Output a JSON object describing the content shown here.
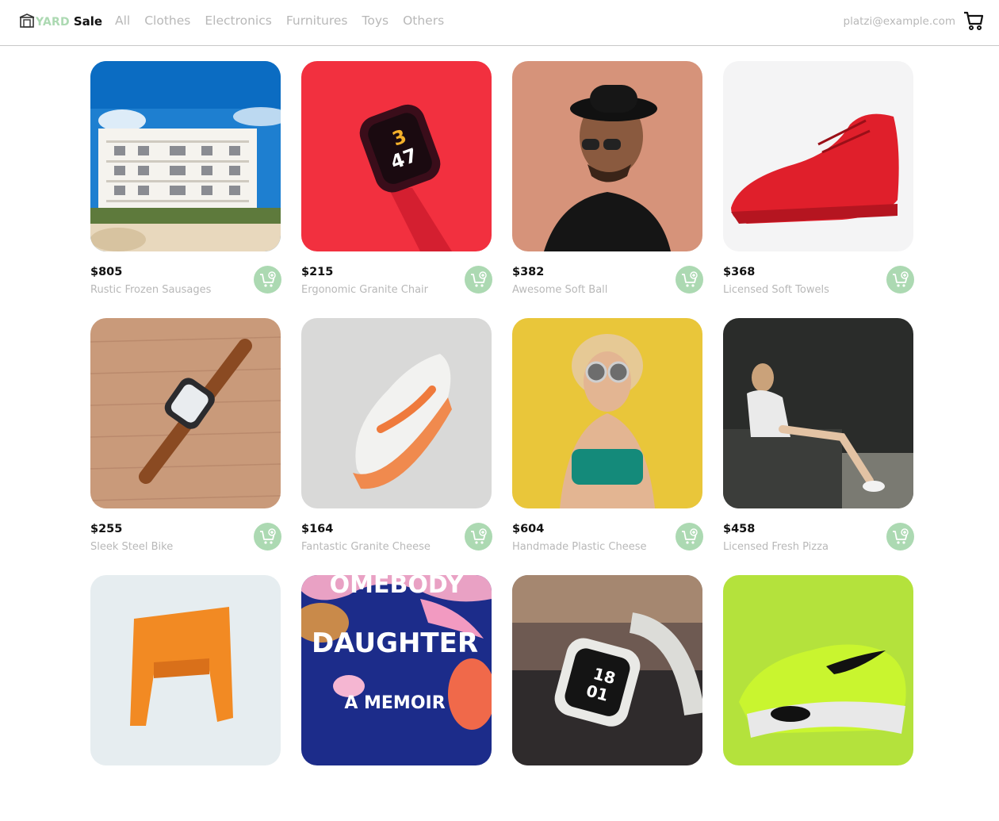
{
  "brand": {
    "word1": "YARD",
    "word2": "Sale",
    "accent": "#acd9b2"
  },
  "nav": {
    "links": [
      "All",
      "Clothes",
      "Electronics",
      "Furnitures",
      "Toys",
      "Others"
    ]
  },
  "account": {
    "email": "platzi@example.com",
    "cart_icon": "shopping-cart-icon"
  },
  "products": [
    {
      "price": "$805",
      "name": "Rustic Frozen Sausages",
      "image": "white apartment building under blue sky"
    },
    {
      "price": "$215",
      "name": "Ergonomic Granite Chair",
      "image": "smartwatch on red background"
    },
    {
      "price": "$382",
      "name": "Awesome Soft Ball",
      "image": "man with hat and sunglasses"
    },
    {
      "price": "$368",
      "name": "Licensed Soft Towels",
      "image": "red sneaker on white"
    },
    {
      "price": "$255",
      "name": "Sleek Steel Bike",
      "image": "watch on wooden table"
    },
    {
      "price": "$164",
      "name": "Fantastic Granite Cheese",
      "image": "orange and white running shoe"
    },
    {
      "price": "$604",
      "name": "Handmade Plastic Cheese",
      "image": "woman with sunglasses on yellow wall"
    },
    {
      "price": "$458",
      "name": "Licensed Fresh Pizza",
      "image": "woman sitting on stone bench"
    },
    {
      "price": "",
      "name": "",
      "image": "orange chair"
    },
    {
      "price": "",
      "name": "",
      "image": "book cover",
      "cover_text": {
        "top": "OMEBODY",
        "title": "DAUGHTER",
        "subtitle": "A MEMOIR"
      }
    },
    {
      "price": "",
      "name": "",
      "image": "white smartwatch",
      "watch_text": {
        "hour": "18",
        "minute": "01"
      }
    },
    {
      "price": "",
      "name": "",
      "image": "neon green sneaker"
    }
  ],
  "card": {
    "add_icon": "add-to-cart-icon"
  }
}
